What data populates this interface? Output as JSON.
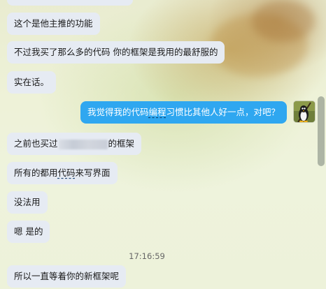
{
  "messages": [
    {
      "text": "这个是他主推的功能"
    },
    {
      "text": "不过我买了那么多的代码 你的框架是我用的最舒服的"
    },
    {
      "text": "实在话。"
    },
    {
      "before": "我觉得我的代码",
      "underlined": "编程",
      "after": "习惯比其他人好一点，对吧？"
    },
    {
      "before": "之前也买过",
      "after": "的框架"
    },
    {
      "before": "所有的都用",
      "underlined": "代码",
      "after": "来写界面"
    },
    {
      "text": "没法用"
    },
    {
      "text": "嗯 是的"
    },
    {
      "text": "所以一直等着你的新框架呢"
    }
  ],
  "timestamp": "17:16:59",
  "colors": {
    "incoming_bubble": "#e6ebf3",
    "outgoing_bubble": "#2fa7f0",
    "outgoing_text": "#ffffff"
  },
  "icons": {
    "avatar": "penguin-avatar-icon"
  }
}
